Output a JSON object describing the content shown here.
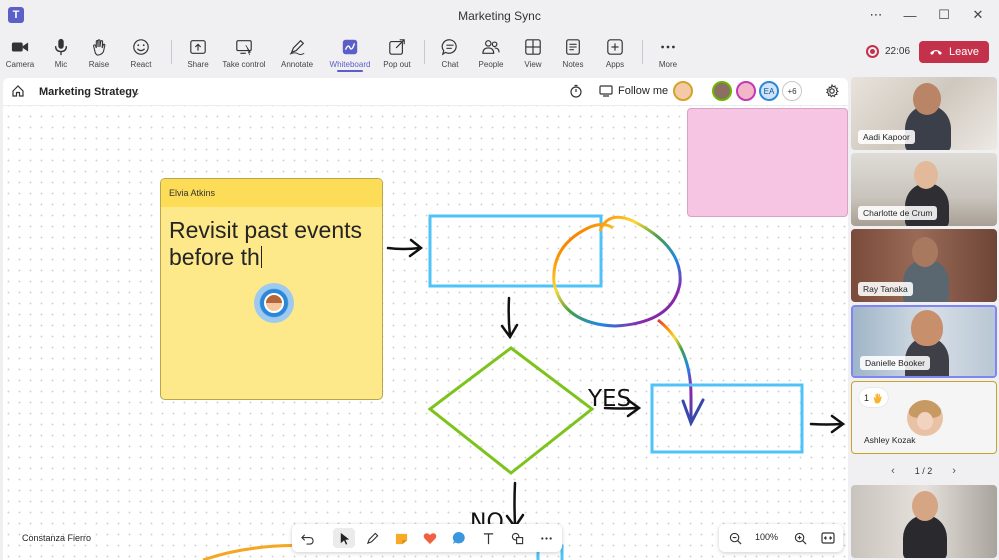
{
  "window": {
    "title": "Marketing Sync"
  },
  "toolbar": {
    "items": [
      {
        "label": "Camera"
      },
      {
        "label": "Mic"
      },
      {
        "label": "Raise"
      },
      {
        "label": "React"
      },
      {
        "label": "Share"
      },
      {
        "label": "Take control"
      },
      {
        "label": "Annotate"
      },
      {
        "label": "Whiteboard"
      },
      {
        "label": "Pop out"
      },
      {
        "label": "Chat"
      },
      {
        "label": "People"
      },
      {
        "label": "View"
      },
      {
        "label": "Notes"
      },
      {
        "label": "Apps"
      },
      {
        "label": "More"
      }
    ],
    "active": "Whiteboard",
    "timer": "22:06",
    "leave_label": "Leave"
  },
  "board": {
    "title": "Marketing Strategy",
    "follow_label": "Follow me",
    "avatars": [
      {
        "initials": ""
      },
      {
        "initials": ""
      },
      {
        "initials": ""
      },
      {
        "initials": "EA"
      }
    ],
    "more_count": "+6",
    "sticky": {
      "author": "Elvia Atkins",
      "text_line1": "Revisit past events",
      "text_line2": "before th"
    },
    "yes_label": "YES",
    "no_label": "NO",
    "presenter": "Constanza Fierro",
    "zoom": "100%"
  },
  "participants": {
    "tiles": [
      {
        "name": "Aadi Kapoor"
      },
      {
        "name": "Charlotte de Crum"
      },
      {
        "name": "Ray Tanaka"
      },
      {
        "name": "Danielle Booker"
      },
      {
        "name": "Ashley Kozak",
        "raise_count": "1"
      }
    ],
    "pager": "1 / 2"
  },
  "colors": {
    "accent": "#5b5fc7",
    "leave": "#c4314b",
    "sticky": "#fde88a",
    "sticky_header": "#fddc58",
    "pink_note": "#f5c5e3",
    "rect_stroke": "#4fc3f7",
    "diamond_stroke": "#7cc31c"
  }
}
